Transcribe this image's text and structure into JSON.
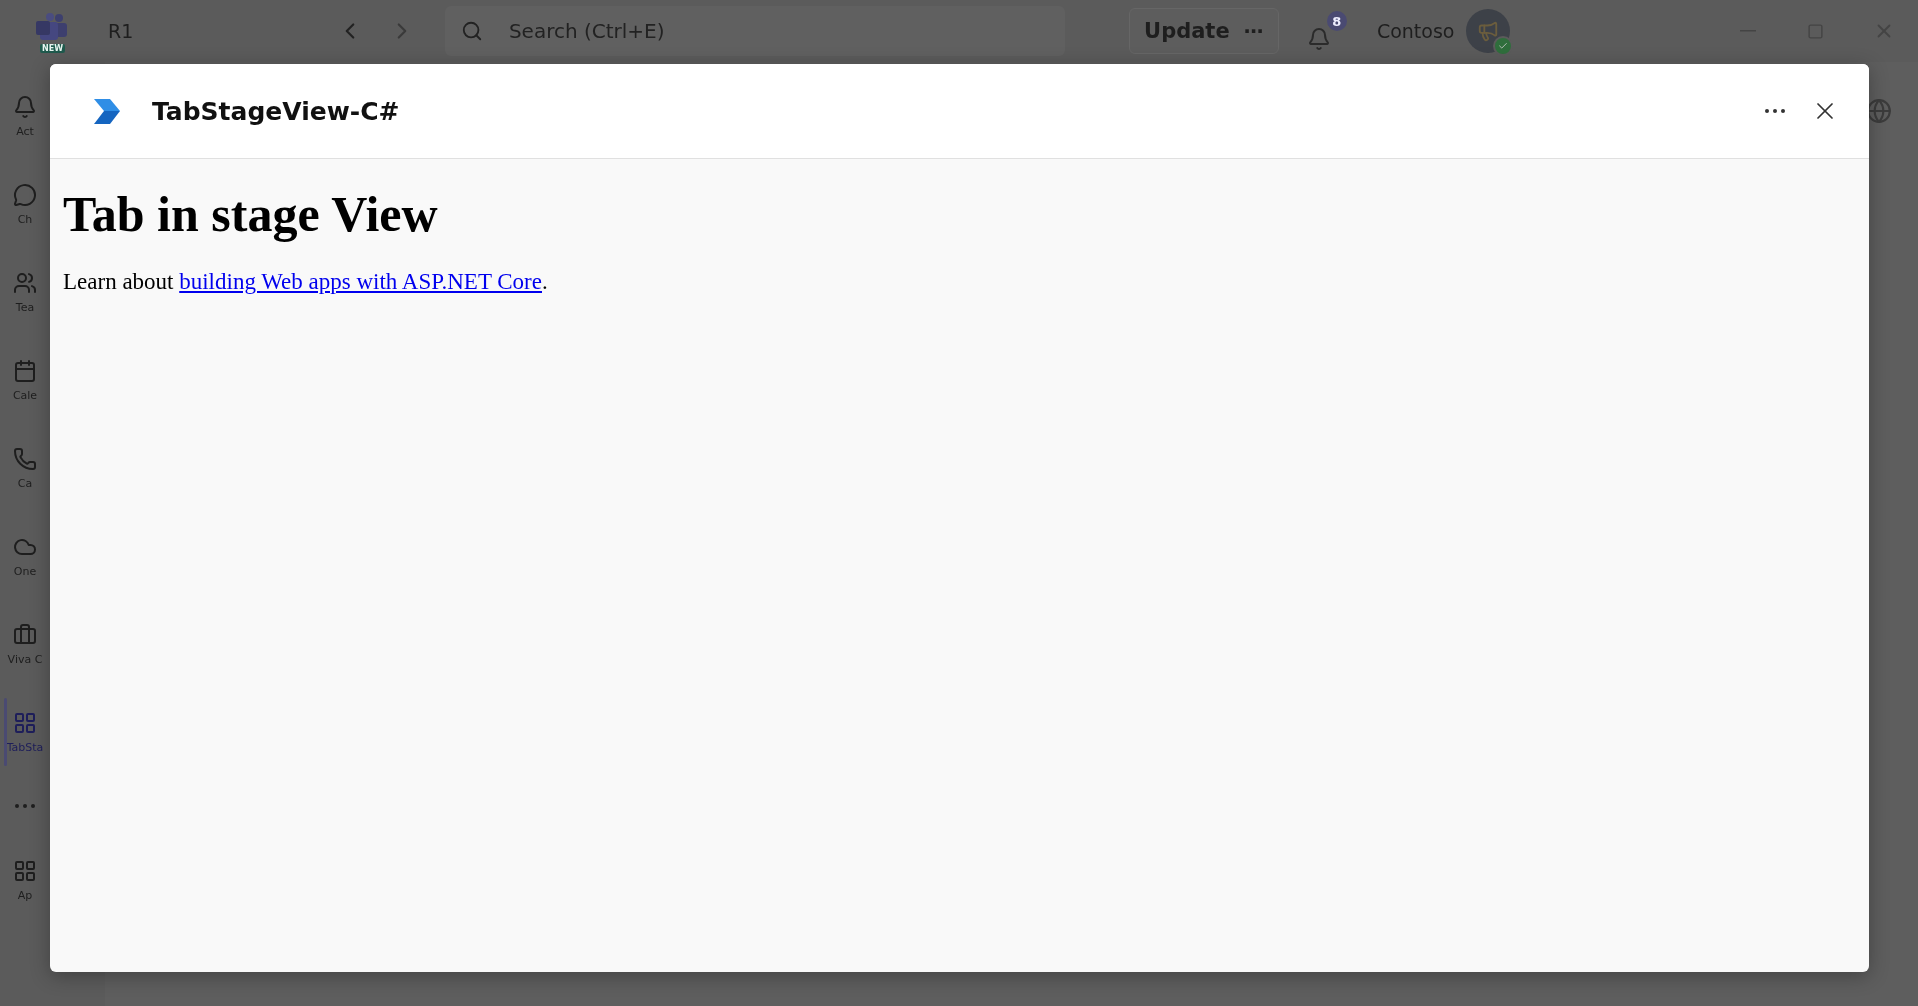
{
  "app_bar": {
    "badge": "NEW",
    "workspace": "R1",
    "search": {
      "placeholder": "Search (Ctrl+E)"
    },
    "update_button": {
      "label": "Update",
      "more": "⋯"
    },
    "notifications": {
      "count": "8"
    },
    "org": "Contoso"
  },
  "sidebar": {
    "items": [
      {
        "label": "Act",
        "selected": false
      },
      {
        "label": "Ch",
        "selected": false
      },
      {
        "label": "Tea",
        "selected": false
      },
      {
        "label": "Cale",
        "selected": false
      },
      {
        "label": "Ca",
        "selected": false
      },
      {
        "label": "One",
        "selected": false
      },
      {
        "label": "Viva C",
        "selected": false
      },
      {
        "label": "TabSta",
        "selected": true
      },
      {
        "selected": false
      },
      {
        "label": "Ap",
        "selected": false
      }
    ]
  },
  "dialog": {
    "title": "TabStageView-C#",
    "heading": "Tab in stage View",
    "paragraph": {
      "before": "Learn about ",
      "link": "building Web apps with ASP.NET Core",
      "after": "."
    }
  }
}
